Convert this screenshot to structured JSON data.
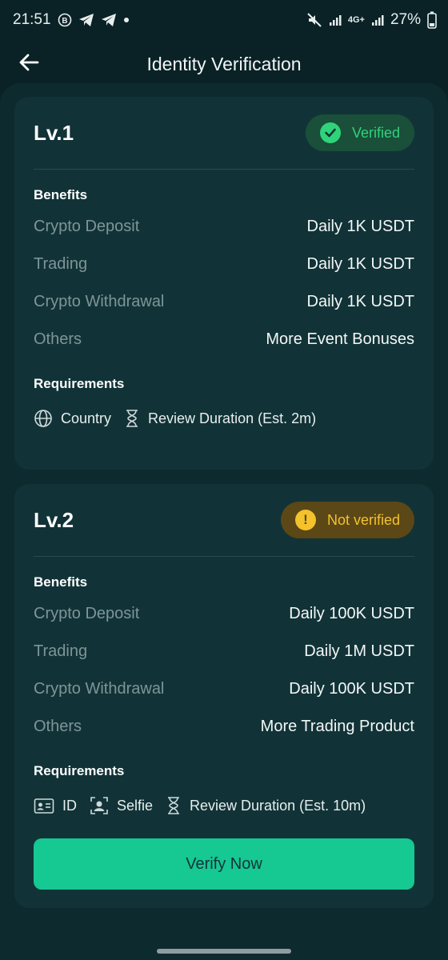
{
  "status_bar": {
    "time": "21:51",
    "battery": "27%",
    "network": "4G+",
    "icons": [
      "b-circle-icon",
      "telegram-icon",
      "telegram-icon",
      "dot-icon",
      "mute-icon",
      "signal-icon",
      "battery-icon"
    ]
  },
  "header": {
    "title": "Identity Verification",
    "back_icon": "arrow-left-icon"
  },
  "cards": [
    {
      "level": "Lv.1",
      "status": "Verified",
      "status_icon": "check-icon",
      "benefits_label": "Benefits",
      "benefits": [
        {
          "label": "Crypto Deposit",
          "value": "Daily 1K USDT"
        },
        {
          "label": "Trading",
          "value": "Daily 1K USDT"
        },
        {
          "label": "Crypto Withdrawal",
          "value": "Daily 1K USDT"
        },
        {
          "label": "Others",
          "value": "More Event Bonuses"
        }
      ],
      "requirements_label": "Requirements",
      "requirements": [
        {
          "icon": "globe-icon",
          "label": "Country"
        },
        {
          "icon": "hourglass-icon",
          "label": "Review Duration (Est. 2m)"
        }
      ]
    },
    {
      "level": "Lv.2",
      "status": "Not verified",
      "status_icon": "exclamation-icon",
      "benefits_label": "Benefits",
      "benefits": [
        {
          "label": "Crypto Deposit",
          "value": "Daily 100K USDT"
        },
        {
          "label": "Trading",
          "value": "Daily 1M USDT"
        },
        {
          "label": "Crypto Withdrawal",
          "value": "Daily 100K USDT"
        },
        {
          "label": "Others",
          "value": "More Trading Product"
        }
      ],
      "requirements_label": "Requirements",
      "requirements": [
        {
          "icon": "id-card-icon",
          "label": "ID"
        },
        {
          "icon": "selfie-icon",
          "label": "Selfie"
        },
        {
          "icon": "hourglass-icon",
          "label": "Review Duration (Est. 10m)"
        }
      ],
      "action_label": "Verify Now"
    }
  ],
  "colors": {
    "background": "#0a2226",
    "card": "#113337",
    "accent_green": "#16c892",
    "verified_text": "#2fd37a",
    "warning": "#f3c22c",
    "muted_text": "#7f9597"
  }
}
